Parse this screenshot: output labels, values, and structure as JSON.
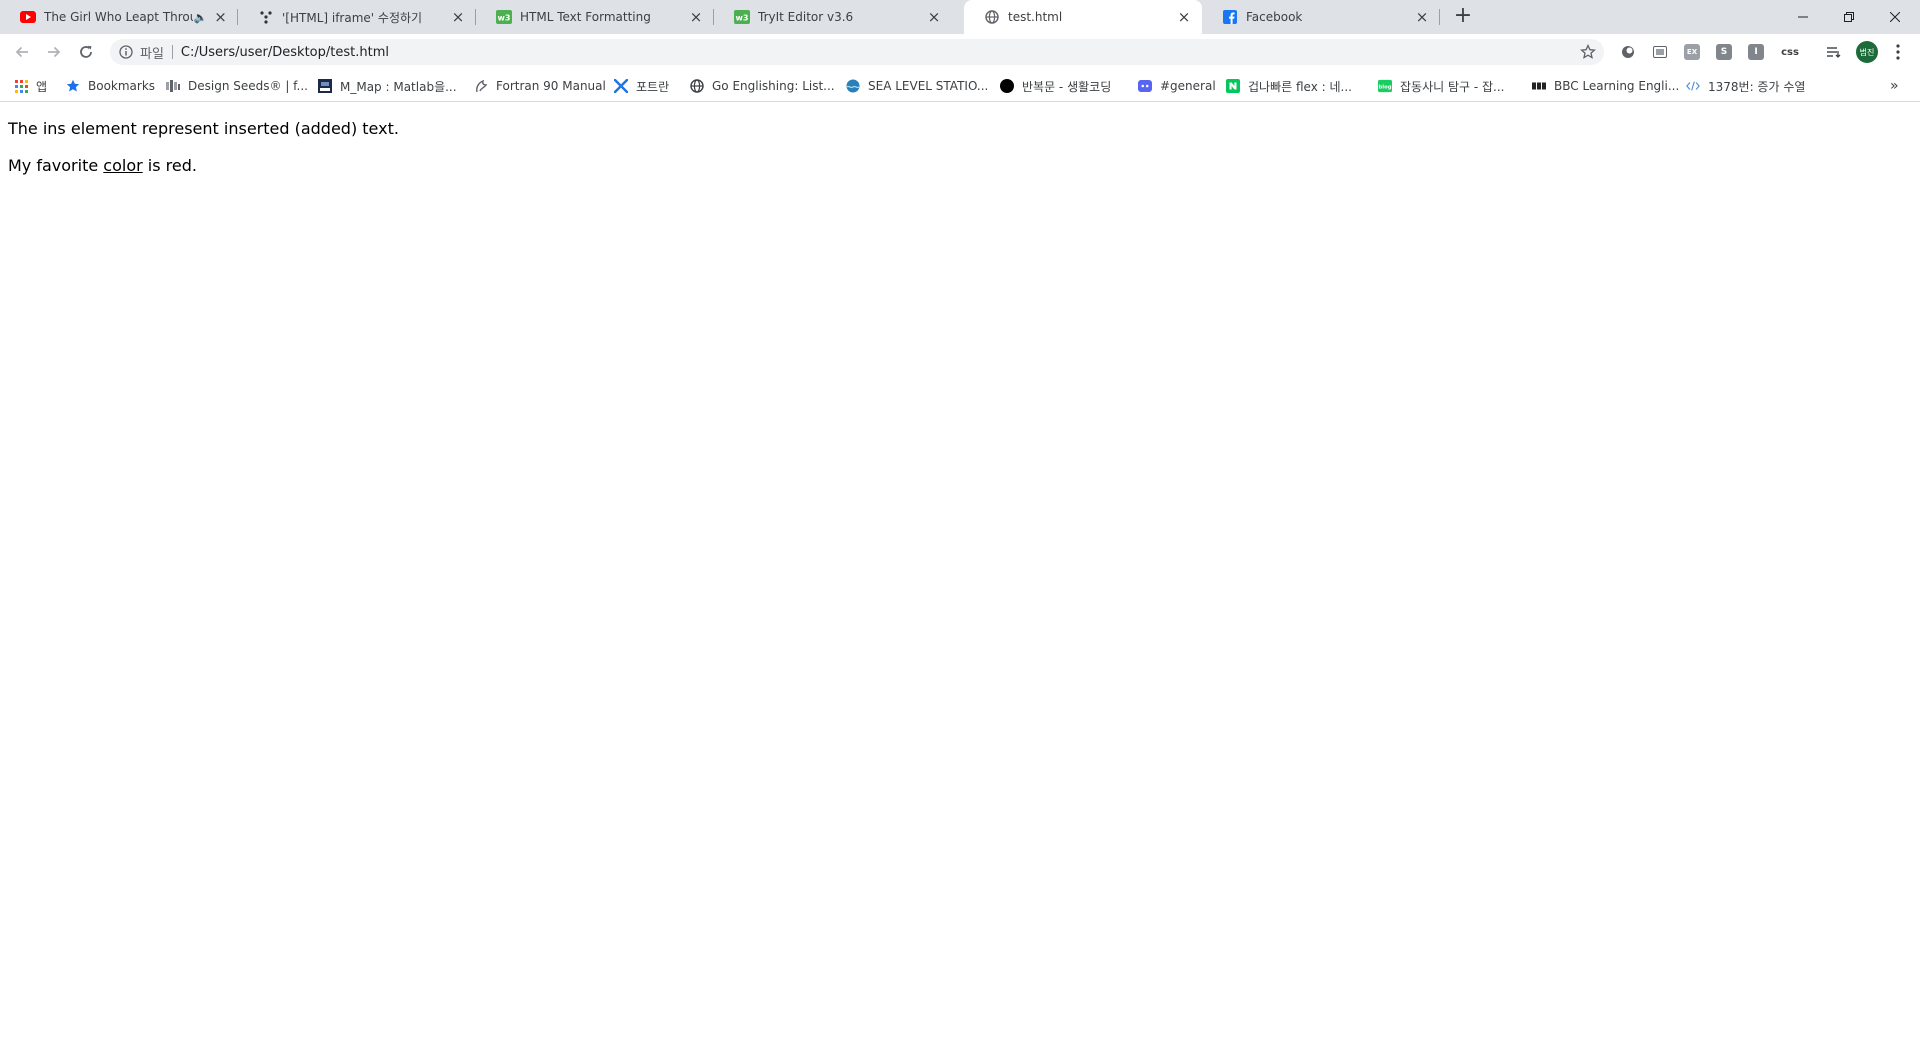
{
  "window": {
    "minimize_label": "—",
    "restore_label": "❐",
    "close_label": "✕"
  },
  "tabs": [
    {
      "title": "The Girl Who Leapt Throug",
      "icon": "youtube-icon",
      "muted": true
    },
    {
      "title": "'[HTML] iframe' 수정하기",
      "icon": "velog-icon"
    },
    {
      "title": "HTML Text Formatting",
      "icon": "w3schools-icon"
    },
    {
      "title": "TryIt Editor v3.6",
      "icon": "w3schools-icon"
    },
    {
      "title": "test.html",
      "icon": "globe-icon",
      "active": true
    },
    {
      "title": "Facebook",
      "icon": "facebook-icon"
    }
  ],
  "new_tab_label": "+",
  "toolbar": {
    "address_chip": "파일",
    "address_url": "C:/Users/user/Desktop/test.html",
    "extensions": [
      "ext-circle-icon",
      "ext-screen-icon",
      "ext-ex-icon",
      "ext-s-icon",
      "ext-i-icon",
      "ext-css-icon",
      "ext-readinglist-icon"
    ],
    "ext_labels": {
      "ex": "EX",
      "s": "S",
      "i": "I",
      "css": "css"
    },
    "profile_label": "범진"
  },
  "bookmarks": [
    {
      "label": "앱",
      "icon": "apps-grid-icon"
    },
    {
      "label": "Bookmarks",
      "icon": "star-icon"
    },
    {
      "label": "Design Seeds® | f...",
      "icon": "design-seeds-icon"
    },
    {
      "label": "M_Map : Matlab을...",
      "icon": "mmap-icon"
    },
    {
      "label": "Fortran 90 Manual",
      "icon": "fortran-icon"
    },
    {
      "label": "포트란",
      "icon": "fortran-x-icon"
    },
    {
      "label": "Go Englishing: List...",
      "icon": "globe-icon"
    },
    {
      "label": "SEA LEVEL STATIO...",
      "icon": "sea-level-icon"
    },
    {
      "label": "반복문 - 생활코딩",
      "icon": "black-circle-icon"
    },
    {
      "label": "#general",
      "icon": "discord-icon"
    },
    {
      "label": "겁나빠른 flex : 네...",
      "icon": "naver-icon"
    },
    {
      "label": "잡동사니 탐구 - 잡...",
      "icon": "blog-icon"
    },
    {
      "label": "BBC Learning Engli...",
      "icon": "bbc-icon"
    },
    {
      "label": "1378번: 증가 수열",
      "icon": "code-icon"
    }
  ],
  "bookmarks_overflow": "»",
  "content": {
    "para1": "The ins element represent inserted (added) text.",
    "para2_before": "My favorite ",
    "para2_ins": "color",
    "para2_after": " is red."
  }
}
